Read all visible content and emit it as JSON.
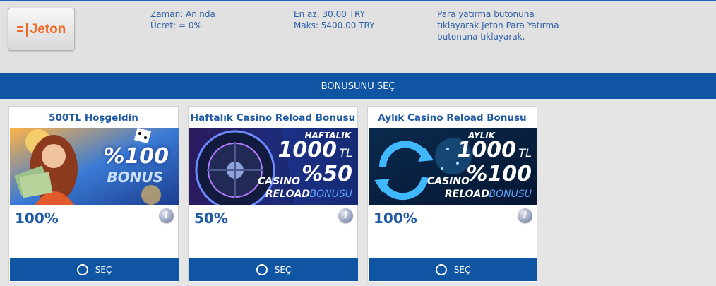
{
  "payment": {
    "provider_name": "Jeton",
    "time_label": "Zaman: Anında",
    "fee_label": "Ücret: = 0%",
    "min_label": "En az: 30.00 TRY",
    "max_label": "Maks: 5400.00 TRY",
    "description": "Para yatırma butonuna tıklayarak Jeton Para Yatırma butonuna tıklayarak."
  },
  "bonus_section": {
    "header": "BONUSUNU SEÇ",
    "cards": [
      {
        "title": "500TL Hoşgeldin",
        "percent": "100%",
        "select_label": "SEÇ",
        "banner": {
          "line1": "%100",
          "line2": "BONUS"
        }
      },
      {
        "title": "Haftalık Casino Reload Bonusu",
        "percent": "50%",
        "select_label": "SEÇ",
        "banner": {
          "tag": "HAFTALIK",
          "amount": "1000",
          "unit": "TL",
          "rate": "%50",
          "line1": "CASINO",
          "line2": "RELOAD",
          "line3": "BONUSU"
        }
      },
      {
        "title": "Aylık Casino Reload Bonusu",
        "percent": "100%",
        "select_label": "SEÇ",
        "banner": {
          "tag": "AYLIK",
          "amount": "1000",
          "unit": "TL",
          "rate": "%100",
          "line1": "CASINO",
          "line2": "RELOAD",
          "line3": "BONUSU"
        }
      }
    ]
  },
  "colors": {
    "primary_blue": "#0f55a3",
    "text_blue": "#1f5aa5",
    "jeton_orange": "#f26722"
  },
  "icons": [
    "jeton-logo-icon",
    "info-icon",
    "radio-icon"
  ]
}
